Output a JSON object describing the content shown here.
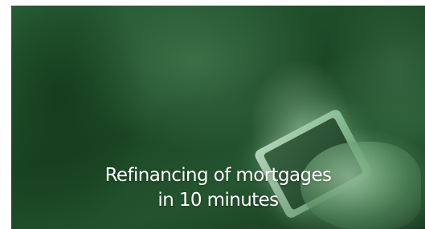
{
  "banner": {
    "headline_line1": "Refinancing of mortgages",
    "headline_line2": "in 10 minutes",
    "image_subject": "hand-holding-tablet-photo",
    "tint_color": "#2e6b3a"
  }
}
